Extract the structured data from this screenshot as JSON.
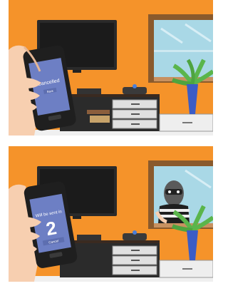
{
  "panels": [
    {
      "phone_screen": {
        "status_text": "Cancelled",
        "button_label": "Back"
      },
      "burglar_visible": false
    },
    {
      "phone_screen": {
        "status_text": "Will be sent in",
        "countdown": "2",
        "button_label": "Cancel"
      },
      "burglar_visible": true
    }
  ],
  "colors": {
    "wall": "#f5932a",
    "floor": "#f0f0f0",
    "tv": "#2a2a2a",
    "window_frame": "#8a5a2c",
    "window_glass": "#a9d8e6",
    "phone_screen": "#6d7fc4",
    "plant_leaf": "#5ab54b",
    "vase": "#3b5cc6",
    "hand": "#f7cfb0"
  }
}
